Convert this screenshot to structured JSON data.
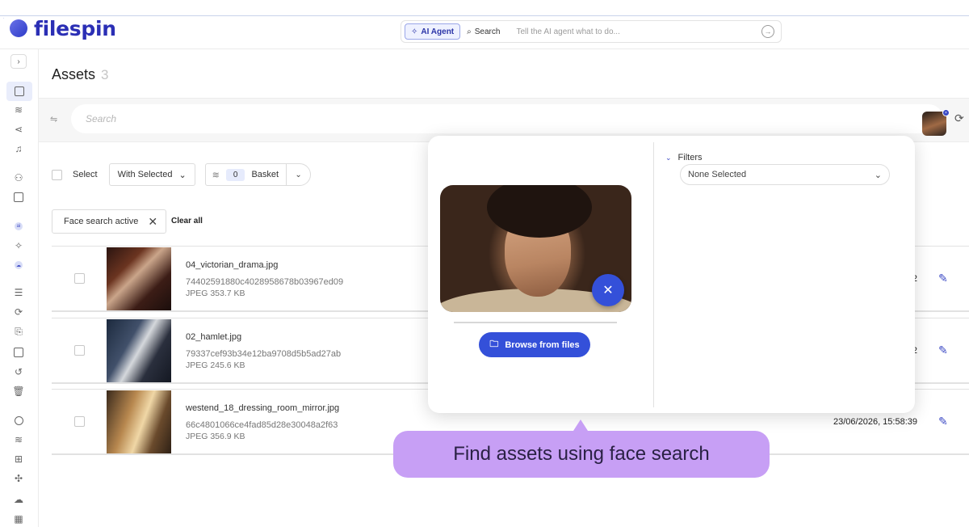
{
  "header": {
    "logo_text": "filespin",
    "ai_agent_label": "AI Agent",
    "search_label": "Search",
    "ai_placeholder": "Tell the AI agent what to do..."
  },
  "sidebar": {
    "icons": [
      "expand-icon",
      "image-icon",
      "layers-icon",
      "share-icon",
      "bell-icon",
      "users-icon",
      "panel-icon",
      "ai-badge-icon",
      "sparkle-icon",
      "cloud-icon",
      "list-icon",
      "sync-icon",
      "clipboard-icon",
      "browser-icon",
      "undo-icon",
      "trash-icon",
      "settings-icon",
      "stack-icon",
      "grid-icon",
      "puzzle-icon",
      "cloud-off-icon",
      "calendar-icon"
    ]
  },
  "main": {
    "title": "Assets",
    "count": "3",
    "search_placeholder": "Search",
    "select_label": "Select",
    "with_selected_label": "With Selected",
    "basket_count": "0",
    "basket_label": "Basket",
    "chip_label": "Face search active",
    "clear_all_label": "Clear all"
  },
  "assets": [
    {
      "name": "04_victorian_drama.jpg",
      "hash": "74402591880c4028958678b03967ed09",
      "meta": "JPEG 353.7 KB",
      "date": "2"
    },
    {
      "name": "02_hamlet.jpg",
      "hash": "79337cef93b34e12ba9708d5b5ad27ab",
      "meta": "JPEG 245.6 KB",
      "date": "2"
    },
    {
      "name": "westend_18_dressing_room_mirror.jpg",
      "hash": "66c4801066ce4fad85d28e30048a2f63",
      "meta": "JPEG 356.9 KB",
      "date": "23/06/2026, 15:58:39"
    }
  ],
  "popup": {
    "browse_label": "Browse from files",
    "filters_label": "Filters",
    "filters_value": "None Selected"
  },
  "callout": {
    "text": "Find assets using face search"
  },
  "colors": {
    "brand": "#2b2fb5",
    "accent": "#3450d9",
    "callout": "#c79ff5"
  }
}
